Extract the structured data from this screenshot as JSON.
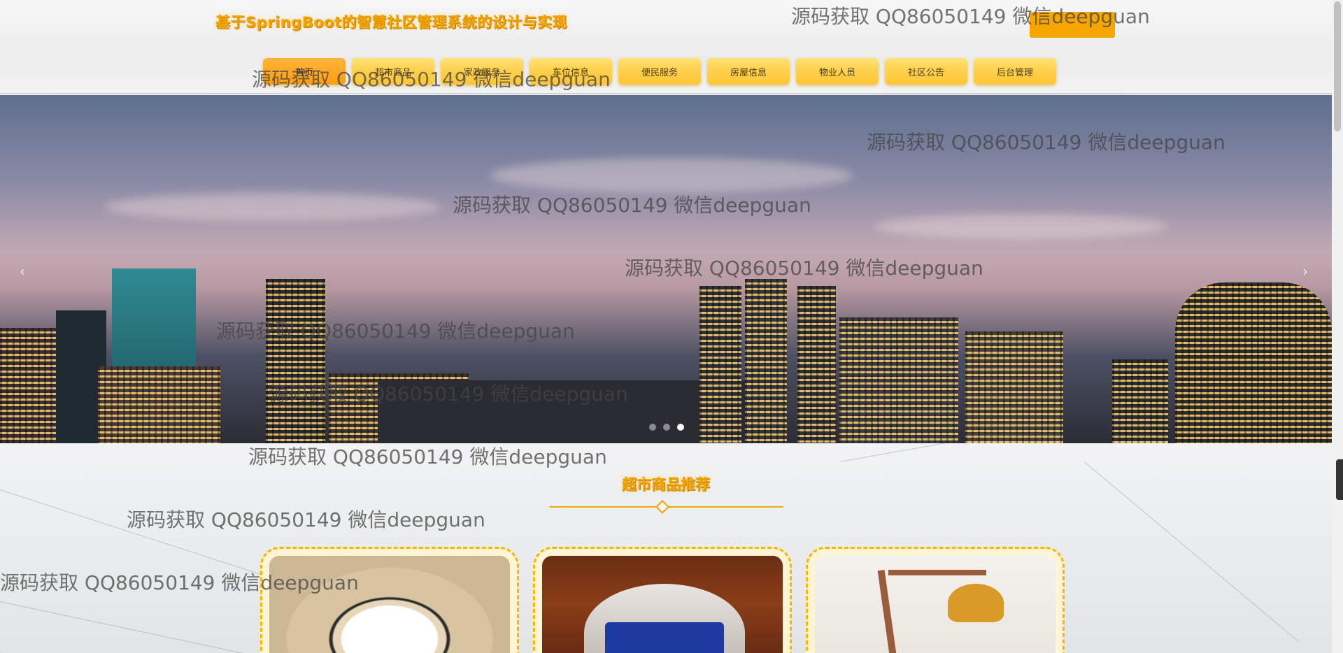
{
  "header": {
    "site_title": "基于SpringBoot的智慧社区管理系统的设计与实现",
    "nav": [
      {
        "label": "首页",
        "active": true
      },
      {
        "label": "超市商品"
      },
      {
        "label": "家政服务"
      },
      {
        "label": "车位信息"
      },
      {
        "label": "便民服务"
      },
      {
        "label": "房屋信息"
      },
      {
        "label": "物业人员"
      },
      {
        "label": "社区公告"
      },
      {
        "label": "后台管理"
      }
    ],
    "accent_color": "#f2a500"
  },
  "banner": {
    "prev_icon": "chevron-left-icon",
    "next_icon": "chevron-right-icon",
    "slide_count": 3,
    "active_slide": 3
  },
  "section": {
    "title": "超市商品推荐"
  },
  "watermark": "源码获取 QQ86050149 微信deepguan"
}
